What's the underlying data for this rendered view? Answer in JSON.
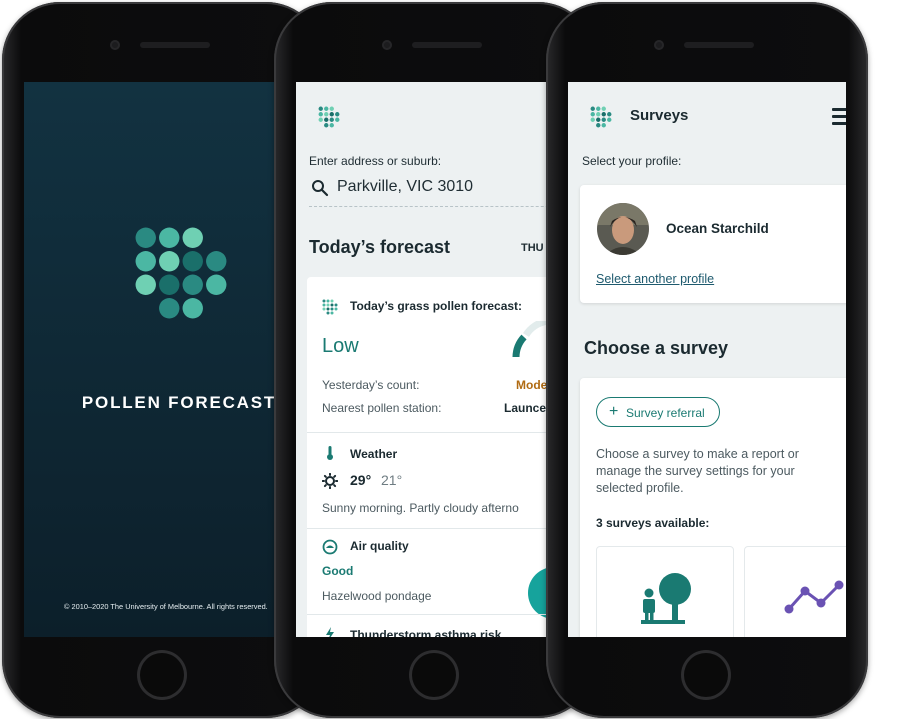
{
  "screens": {
    "splash": {
      "app_title": "POLLEN FORECAST",
      "copyright": "© 2010–2020 The University of Melbourne. All rights reserved."
    },
    "forecast": {
      "address_label": "Enter address or suburb:",
      "address_value": "Parkville, VIC 3010",
      "section_title": "Today’s forecast",
      "day_label": "THU",
      "grass_heading": "Today’s grass pollen forecast:",
      "level": "Low",
      "yesterday_label": "Yesterday’s count:",
      "yesterday_value": "Mode",
      "station_label": "Nearest pollen station:",
      "station_value": "Launce",
      "weather_heading": "Weather",
      "temp_high": "29°",
      "temp_low": "21°",
      "weather_desc": "Sunny morning. Partly cloudy afterno",
      "air_heading": "Air quality",
      "air_status": "Good",
      "air_location": "Hazelwood pondage",
      "thunder_heading": "Thunderstorm asthma risk"
    },
    "surveys": {
      "title": "Surveys",
      "profile_label": "Select your profile:",
      "profile_name": "Ocean Starchild",
      "select_another": "Select another profile",
      "choose_title": "Choose a survey",
      "referral_button": "Survey referral",
      "description": "Choose a survey to make a report or manage the survey settings for your selected profile.",
      "count_text": "3 surveys available:",
      "tiles": [
        {
          "icon": "person-tree-icon"
        },
        {
          "icon": "trend-line-icon"
        }
      ]
    }
  },
  "colors": {
    "brand_teal": "#1a7a72",
    "splash_bg": "#123241",
    "screen_bg": "#edf1f2",
    "moderate": "#b06b12",
    "survey_purple": "#6a52b3"
  }
}
